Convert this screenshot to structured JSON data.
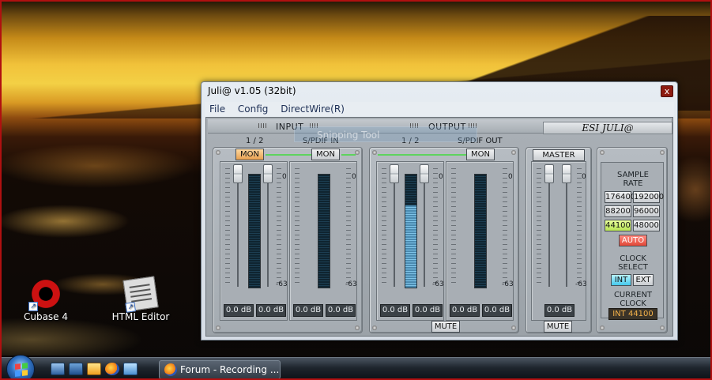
{
  "desktop": {
    "icons": [
      {
        "label": "Cubase 4"
      },
      {
        "label": "HTML Editor"
      }
    ]
  },
  "snipping_tool": {
    "label": "Snipping Tool"
  },
  "taskbar": {
    "task_button_label": "Forum - Recording ..."
  },
  "window": {
    "title": "Juli@ v1.05 (32bit)",
    "close_label": "x",
    "menu": [
      "File",
      "Config",
      "DirectWire(R)"
    ],
    "logo": "ESI JULI@",
    "input_header": "INPUT",
    "output_header": "OUTPUT",
    "input": {
      "analog_label": "1 / 2",
      "spdif_label": "S/PDIF IN",
      "mon_analog": "MON",
      "mon_analog_active": true,
      "mon_spdif": "MON",
      "scale_top": "0",
      "scale_bottom": "-63",
      "channels": [
        {
          "db_left": "0.0 dB",
          "db_right": "0.0 dB",
          "meter_level": 0
        },
        {
          "db_left": "0.0 dB",
          "db_right": "0.0 dB",
          "meter_level": 0
        }
      ]
    },
    "output": {
      "analog_label": "1 / 2",
      "spdif_label": "S/PDIF OUT",
      "mon_spdif": "MON",
      "mute_label": "MUTE",
      "scale_top": "0",
      "scale_bottom": "-63",
      "channels": [
        {
          "db_left": "0.0 dB",
          "db_right": "0.0 dB",
          "meter_level": 0.73
        },
        {
          "db_left": "0.0 dB",
          "db_right": "0.0 dB",
          "meter_level": 0
        }
      ]
    },
    "master": {
      "label": "MASTER",
      "scale_top": "0",
      "scale_bottom": "-63",
      "db": "0.0 dB",
      "mute_label": "MUTE"
    },
    "sample_rate": {
      "label_line1": "SAMPLE",
      "label_line2": "RATE",
      "rates": [
        "176400",
        "192000",
        "88200",
        "96000",
        "44100",
        "48000"
      ],
      "selected": "44100",
      "auto_label": "AUTO",
      "clock_label_line1": "CLOCK",
      "clock_label_line2": "SELECT",
      "int_label": "INT",
      "ext_label": "EXT",
      "clock_selected": "INT",
      "current_label_line1": "CURRENT",
      "current_label_line2": "CLOCK",
      "current_value": "INT 44100"
    }
  },
  "colors": {
    "mon_active": "#e8a050",
    "rate_selected": "#b8e455",
    "auto": "#e04838",
    "clock_selected": "#44c8ec",
    "link_line": "#5ed35e"
  }
}
